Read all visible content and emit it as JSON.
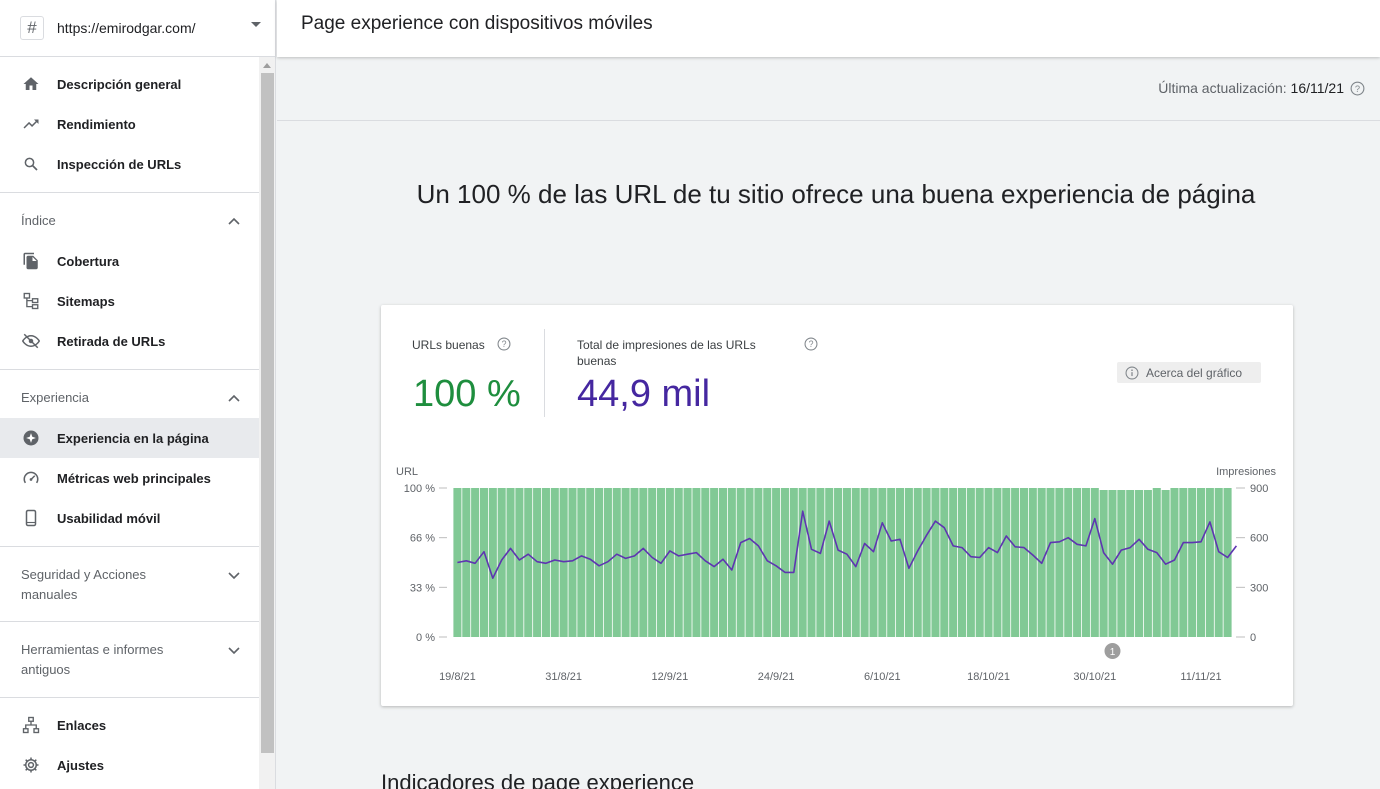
{
  "property": {
    "url": "https://emirodgar.com/"
  },
  "header": {
    "title": "Page experience con dispositivos móviles"
  },
  "updated": {
    "label": "Última actualización:",
    "value": "16/11/21"
  },
  "nav": {
    "top": [
      {
        "label": "Descripción general",
        "icon": "home-icon"
      },
      {
        "label": "Rendimiento",
        "icon": "trending-up-icon"
      },
      {
        "label": "Inspección de URLs",
        "icon": "search-icon"
      }
    ],
    "indice": {
      "label": "Índice",
      "items": [
        {
          "label": "Cobertura",
          "icon": "copy-pages-icon"
        },
        {
          "label": "Sitemaps",
          "icon": "sitemap-icon"
        },
        {
          "label": "Retirada de URLs",
          "icon": "eye-off-icon"
        }
      ]
    },
    "experiencia": {
      "label": "Experiencia",
      "items": [
        {
          "label": "Experiencia en la página",
          "icon": "page-experience-icon"
        },
        {
          "label": "Métricas web principales",
          "icon": "gauge-icon"
        },
        {
          "label": "Usabilidad móvil",
          "icon": "phone-icon"
        }
      ]
    },
    "seguridad": {
      "label": "Seguridad y Acciones manuales"
    },
    "herramientas": {
      "label": "Herramientas e informes antiguos"
    },
    "bottom": [
      {
        "label": "Enlaces",
        "icon": "links-icon"
      },
      {
        "label": "Ajustes",
        "icon": "gear-icon"
      }
    ]
  },
  "headline": "Un 100 % de las URL de tu sitio ofrece una buena experiencia de página",
  "card": {
    "good_urls_label": "URLs buenas",
    "good_urls_value": "100 %",
    "impressions_label": "Total de impresiones de las URLs buenas",
    "impressions_value": "44,9 mil",
    "about_label": "Acerca del gráfico",
    "colors": {
      "good": "#1e8e3e",
      "impressions": "#4527a0",
      "bars": "#81c995",
      "line": "#5e35b1"
    }
  },
  "bottom_heading": "Indicadores de page experience",
  "chart_data": {
    "type": "bar",
    "x_tick_labels": [
      "19/8/21",
      "31/8/21",
      "12/9/21",
      "24/9/21",
      "6/10/21",
      "18/10/21",
      "30/10/21",
      "11/11/21"
    ],
    "start_date": "2021-08-19",
    "end_date": "2021-11-14",
    "left_axis": {
      "label": "URL",
      "ticks": [
        "0 %",
        "33 %",
        "66 %",
        "100 %"
      ],
      "ylim": [
        0,
        100
      ]
    },
    "right_axis": {
      "label": "Impresiones",
      "ticks": [
        "0",
        "300",
        "600",
        "900"
      ],
      "ylim": [
        0,
        900
      ]
    },
    "annotation": {
      "label": "1",
      "date": "2021-11-01"
    },
    "series": [
      {
        "name": "URLs buenas",
        "kind": "bar",
        "axis": "left",
        "values": [
          100,
          100,
          100,
          100,
          100,
          100,
          100,
          100,
          100,
          100,
          100,
          100,
          100,
          100,
          100,
          100,
          100,
          100,
          100,
          100,
          100,
          100,
          100,
          100,
          100,
          100,
          100,
          100,
          100,
          100,
          100,
          100,
          100,
          100,
          100,
          100,
          100,
          100,
          100,
          100,
          100,
          100,
          100,
          100,
          100,
          100,
          100,
          100,
          100,
          100,
          100,
          100,
          100,
          100,
          100,
          100,
          100,
          100,
          100,
          100,
          100,
          100,
          100,
          100,
          100,
          100,
          100,
          100,
          100,
          100,
          100,
          100,
          100,
          100,
          100,
          100,
          100,
          100,
          100,
          100,
          100,
          100,
          100,
          100,
          100,
          100,
          100,
          100
        ]
      },
      {
        "name": "Impresiones",
        "kind": "line",
        "axis": "right",
        "values": [
          450,
          460,
          445,
          515,
          355,
          465,
          535,
          465,
          500,
          455,
          445,
          465,
          455,
          460,
          490,
          470,
          430,
          455,
          500,
          475,
          490,
          535,
          480,
          445,
          520,
          490,
          500,
          510,
          460,
          425,
          470,
          405,
          570,
          595,
          550,
          460,
          430,
          390,
          390,
          760,
          530,
          505,
          700,
          525,
          500,
          425,
          565,
          515,
          690,
          580,
          590,
          415,
          520,
          615,
          700,
          660,
          550,
          540,
          485,
          480,
          540,
          510,
          610,
          545,
          540,
          495,
          445,
          570,
          575,
          600,
          560,
          550,
          715,
          510,
          440,
          525,
          540,
          590,
          530,
          510,
          440,
          465,
          570,
          570,
          575,
          695,
          515,
          480,
          550
        ]
      }
    ]
  }
}
